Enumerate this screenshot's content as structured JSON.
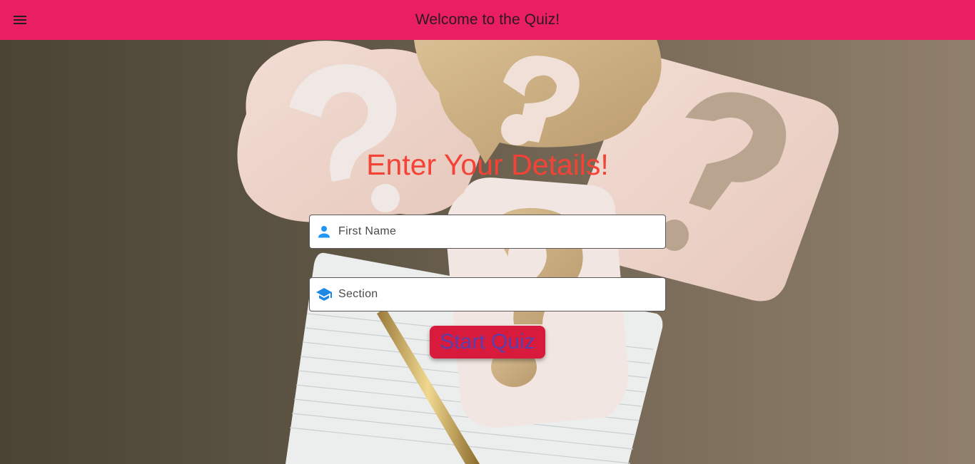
{
  "appbar": {
    "title": "Welcome to the Quiz!",
    "menu_icon": "menu-icon",
    "color": "#e91e63"
  },
  "main": {
    "heading": "Enter Your Details!",
    "heading_color": "#f44336",
    "fields": [
      {
        "placeholder": "First Name",
        "value": "",
        "icon": "person-icon"
      },
      {
        "placeholder": "Section",
        "value": "",
        "icon": "school-icon"
      }
    ],
    "start_button": {
      "label": "Start Quiz",
      "color": "#d81b3d",
      "text_color": "#5b3fa8"
    }
  }
}
